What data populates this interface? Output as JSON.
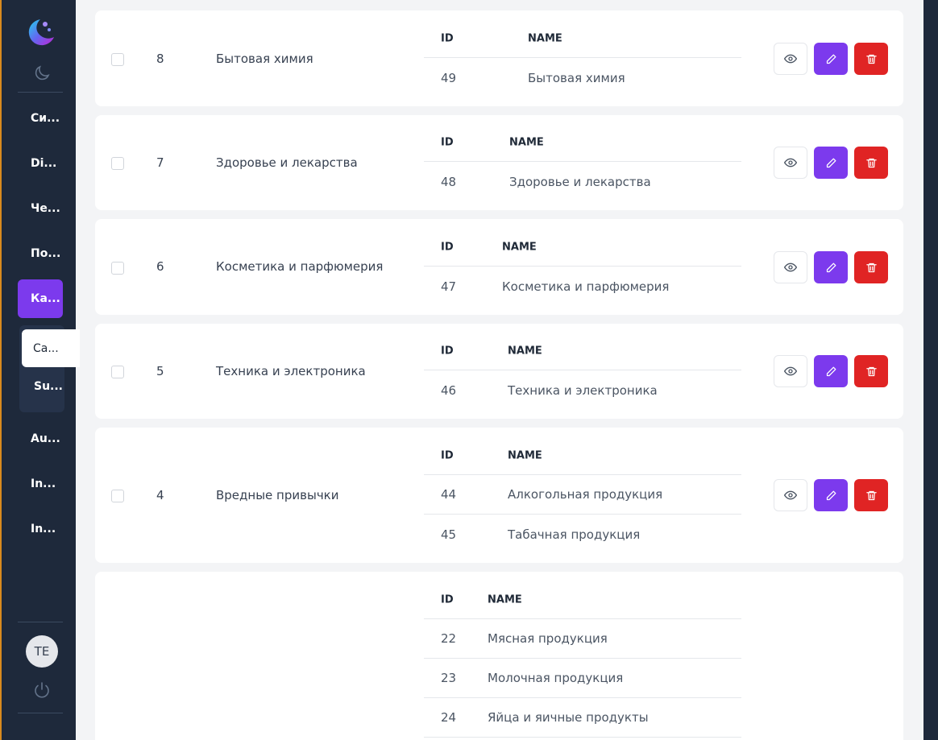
{
  "sidebar": {
    "items": [
      {
        "label": "Си..."
      },
      {
        "label": "Di..."
      },
      {
        "label": "Че..."
      },
      {
        "label": "По..."
      },
      {
        "label": "Ка..."
      },
      {
        "label": "Au..."
      },
      {
        "label": "In..."
      },
      {
        "label": "In..."
      }
    ],
    "submenu": [
      {
        "label": "Ca..."
      },
      {
        "label": "Su..."
      }
    ],
    "avatar_initials": "TE",
    "accent_color": "#7c3aed"
  },
  "table": {
    "sub_headers": {
      "id": "ID",
      "name": "NAME"
    },
    "rows": [
      {
        "num": "8",
        "name": "Бытовая химия",
        "subs": [
          {
            "id": "49",
            "name": "Бытовая химия"
          }
        ]
      },
      {
        "num": "7",
        "name": "Здоровье и лекарства",
        "subs": [
          {
            "id": "48",
            "name": "Здоровье и лекарства"
          }
        ]
      },
      {
        "num": "6",
        "name": "Косметика и парфюмерия",
        "subs": [
          {
            "id": "47",
            "name": "Косметика и парфюмерия"
          }
        ]
      },
      {
        "num": "5",
        "name": "Техника и электроника",
        "subs": [
          {
            "id": "46",
            "name": "Техника и электроника"
          }
        ]
      },
      {
        "num": "4",
        "name": "Вредные привычки",
        "subs": [
          {
            "id": "44",
            "name": "Алкогольная продукция"
          },
          {
            "id": "45",
            "name": "Табачная продукция"
          }
        ]
      },
      {
        "num": "",
        "name": "",
        "subs": [
          {
            "id": "22",
            "name": "Мясная продукция"
          },
          {
            "id": "23",
            "name": "Молочная продукция"
          },
          {
            "id": "24",
            "name": "Яйца и яичные продукты"
          }
        ]
      }
    ]
  },
  "colors": {
    "edit": "#7c3aed",
    "delete": "#e02424"
  }
}
